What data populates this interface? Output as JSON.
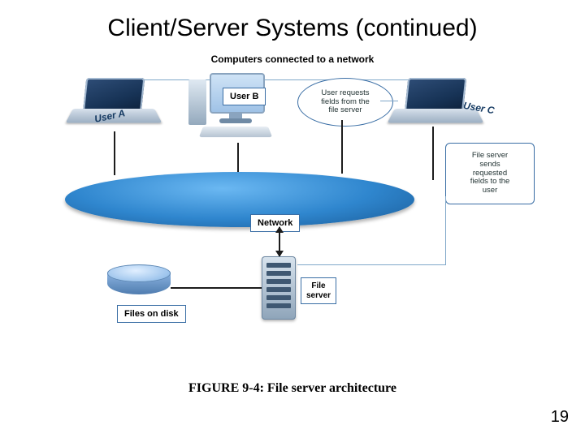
{
  "title": "Client/Server Systems (continued)",
  "subtitle": "Computers connected to a network",
  "figure_caption": "FIGURE 9-4: File server architecture",
  "page_number": "19",
  "labels": {
    "user_a": "User A",
    "user_b": "User B",
    "user_c": "User C",
    "network": "Network",
    "files_on_disk": "Files on disk",
    "file_server": "File\nserver"
  },
  "callouts": {
    "request": "User requests\nfields from the\nfile server",
    "response": "File server\nsends\nrequested\nfields to the\nuser"
  },
  "chart_data": {
    "type": "diagram",
    "description": "File server architecture network diagram",
    "nodes": [
      {
        "id": "user_a",
        "kind": "client-laptop",
        "label": "User A"
      },
      {
        "id": "user_b",
        "kind": "client-desktop",
        "label": "User B"
      },
      {
        "id": "user_c",
        "kind": "client-laptop",
        "label": "User C"
      },
      {
        "id": "network",
        "kind": "network",
        "label": "Network"
      },
      {
        "id": "file_server",
        "kind": "server",
        "label": "File server"
      },
      {
        "id": "files_on_disk",
        "kind": "storage",
        "label": "Files on disk"
      }
    ],
    "edges": [
      {
        "from": "user_a",
        "to": "network"
      },
      {
        "from": "user_b",
        "to": "network"
      },
      {
        "from": "user_c",
        "to": "network"
      },
      {
        "from": "network",
        "to": "file_server"
      },
      {
        "from": "file_server",
        "to": "files_on_disk"
      }
    ],
    "annotations": [
      {
        "attached_to": "user_c",
        "text": "User requests fields from the file server"
      },
      {
        "attached_to": "file_server",
        "text": "File server sends requested fields to the user"
      }
    ]
  }
}
